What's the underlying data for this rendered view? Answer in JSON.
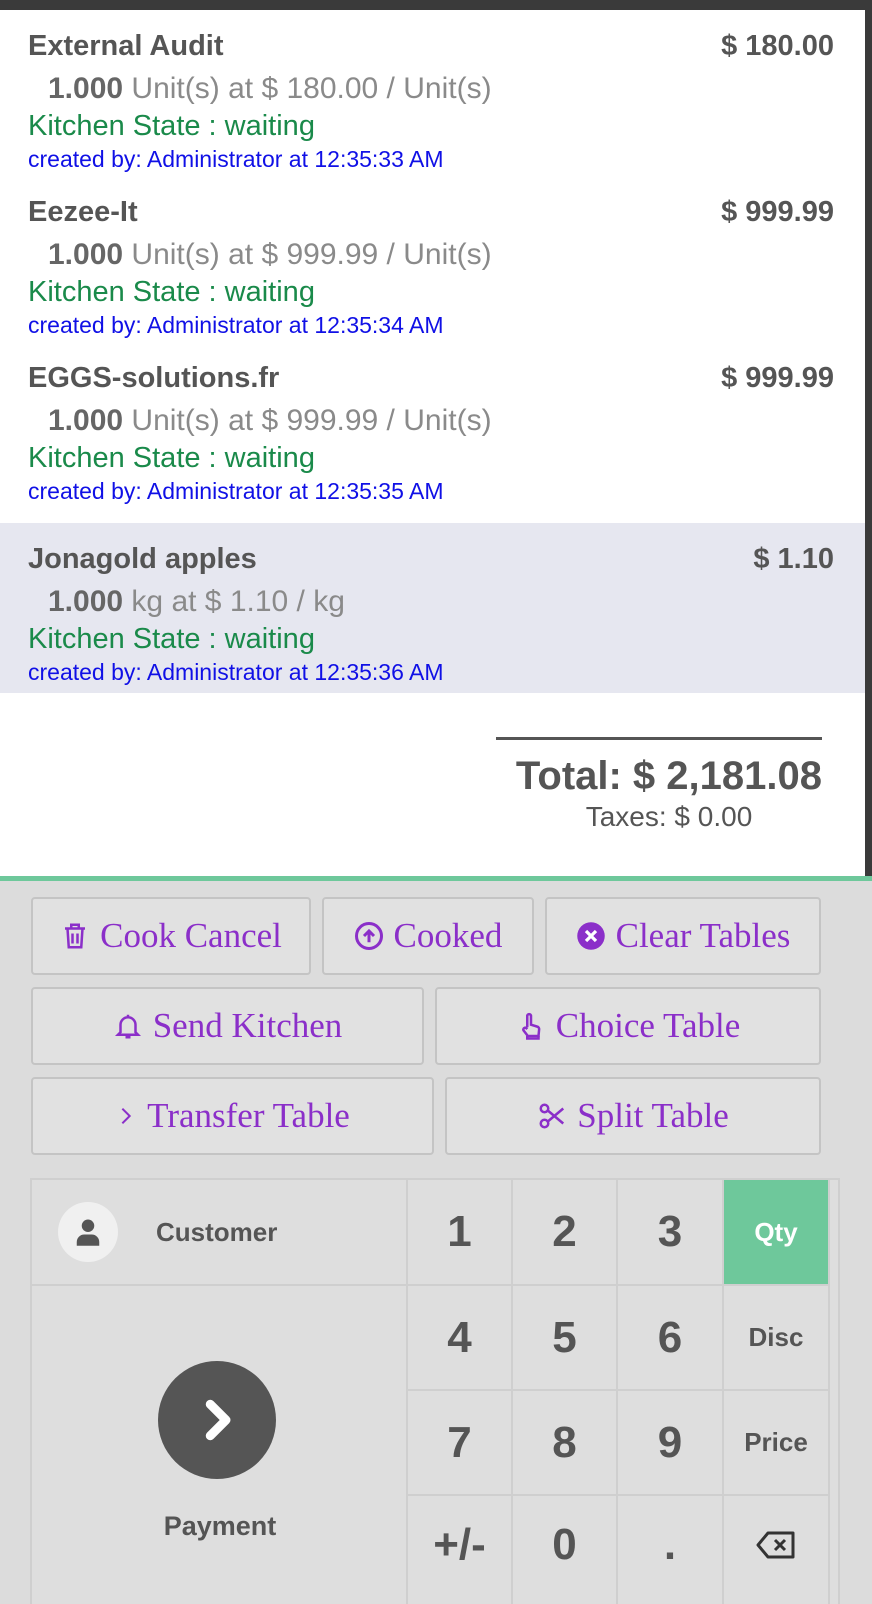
{
  "order": {
    "lines": [
      {
        "name": "External Audit",
        "price": "$ 180.00",
        "qty": "1.000",
        "qty_detail": "Unit(s) at $ 180.00 / Unit(s)",
        "kitchen_state": "Kitchen State : waiting",
        "created": "created by: Administrator at 12:35:33 AM",
        "selected": false
      },
      {
        "name": "Eezee-It",
        "price": "$ 999.99",
        "qty": "1.000",
        "qty_detail": "Unit(s) at $ 999.99 / Unit(s)",
        "kitchen_state": "Kitchen State : waiting",
        "created": "created by: Administrator at 12:35:34 AM",
        "selected": false
      },
      {
        "name": "EGGS-solutions.fr",
        "price": "$ 999.99",
        "qty": "1.000",
        "qty_detail": "Unit(s) at $ 999.99 / Unit(s)",
        "kitchen_state": "Kitchen State : waiting",
        "created": "created by: Administrator at 12:35:35 AM",
        "selected": false
      },
      {
        "name": "Jonagold apples",
        "price": "$ 1.10",
        "qty": "1.000",
        "qty_detail": "kg at $ 1.10 / kg",
        "kitchen_state": "Kitchen State : waiting",
        "created": "created by: Administrator at 12:35:36 AM",
        "selected": true
      }
    ],
    "total": "Total: $ 2,181.08",
    "taxes": "Taxes: $ 0.00"
  },
  "controls": {
    "cook_cancel": {
      "label": "Cook Cancel",
      "icon": "trash-icon"
    },
    "cooked": {
      "label": "Cooked",
      "icon": "arrow-up-circle-icon"
    },
    "clear_tables": {
      "label": "Clear Tables",
      "icon": "times-circle-icon"
    },
    "send_kitchen": {
      "label": "Send Kitchen",
      "icon": "bell-icon"
    },
    "choice_table": {
      "label": "Choice Table",
      "icon": "hand-pointer-icon"
    },
    "transfer_table": {
      "label": "Transfer Table",
      "icon": "chevron-right-icon"
    },
    "split_table": {
      "label": "Split Table",
      "icon": "scissors-icon"
    }
  },
  "numpad": {
    "customer": "Customer",
    "payment": "Payment",
    "keys": [
      "1",
      "2",
      "3",
      "4",
      "5",
      "6",
      "7",
      "8",
      "9",
      "+/-",
      "0",
      "."
    ],
    "modes": [
      "Qty",
      "Disc",
      "Price"
    ],
    "active_mode": "Qty",
    "backspace_icon": "backspace-icon"
  },
  "colors": {
    "accent_green": "#6ec89b",
    "control_text": "#8b2fc9",
    "kitchen_state": "#1a8a4a",
    "created_by": "#1010e6",
    "selected_line": "#e6e7f0"
  }
}
